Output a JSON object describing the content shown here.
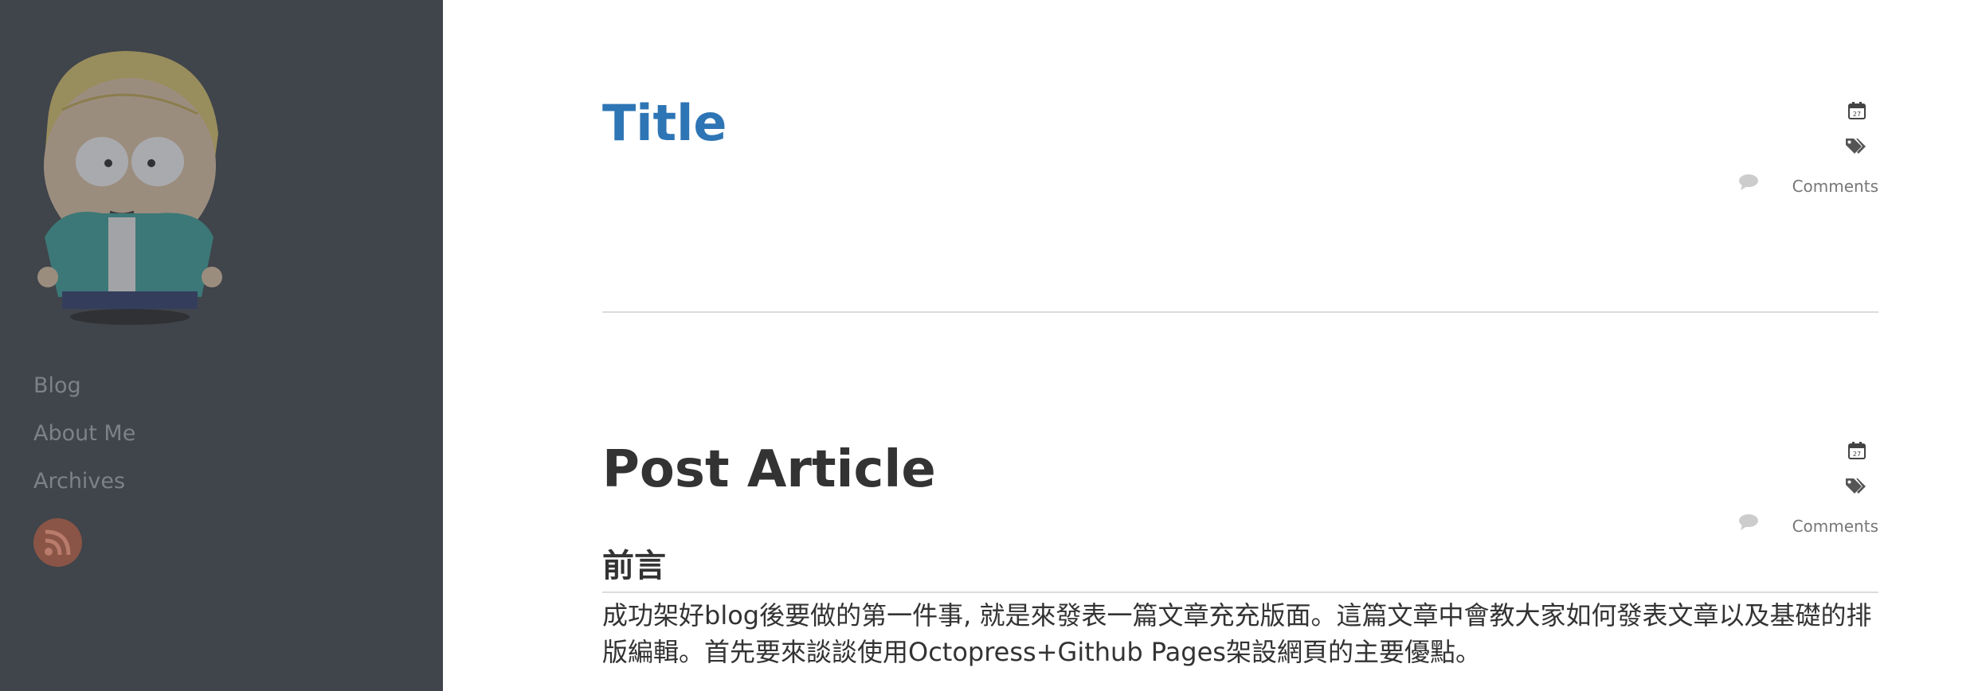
{
  "sidebar": {
    "nav": [
      {
        "label": "Blog"
      },
      {
        "label": "About Me"
      },
      {
        "label": "Archives"
      }
    ],
    "rss_icon": "rss-icon",
    "avatar_icon": "cartoon-avatar"
  },
  "posts": [
    {
      "title": "Title",
      "meta": {
        "date_icon": "calendar-icon",
        "tags_icon": "tags-icon",
        "comments_icon": "comment-icon",
        "comments_label": "Comments"
      }
    },
    {
      "title": "Post Article",
      "meta": {
        "date_icon": "calendar-icon",
        "tags_icon": "tags-icon",
        "comments_icon": "comment-icon",
        "comments_label": "Comments"
      },
      "section_heading": "前言",
      "body": "成功架好blog後要做的第一件事, 就是來發表一篇文章充充版面。這篇文章中會教大家如何發表文章以及基礎的排版編輯。首先要來談談使用Octopress+Github Pages架設網頁的主要優點。"
    }
  ],
  "colors": {
    "sidebar_bg": "#40444b",
    "link_blue": "#2e75b5",
    "nav_text": "#7d8188",
    "rss_bg": "#8a5546"
  }
}
